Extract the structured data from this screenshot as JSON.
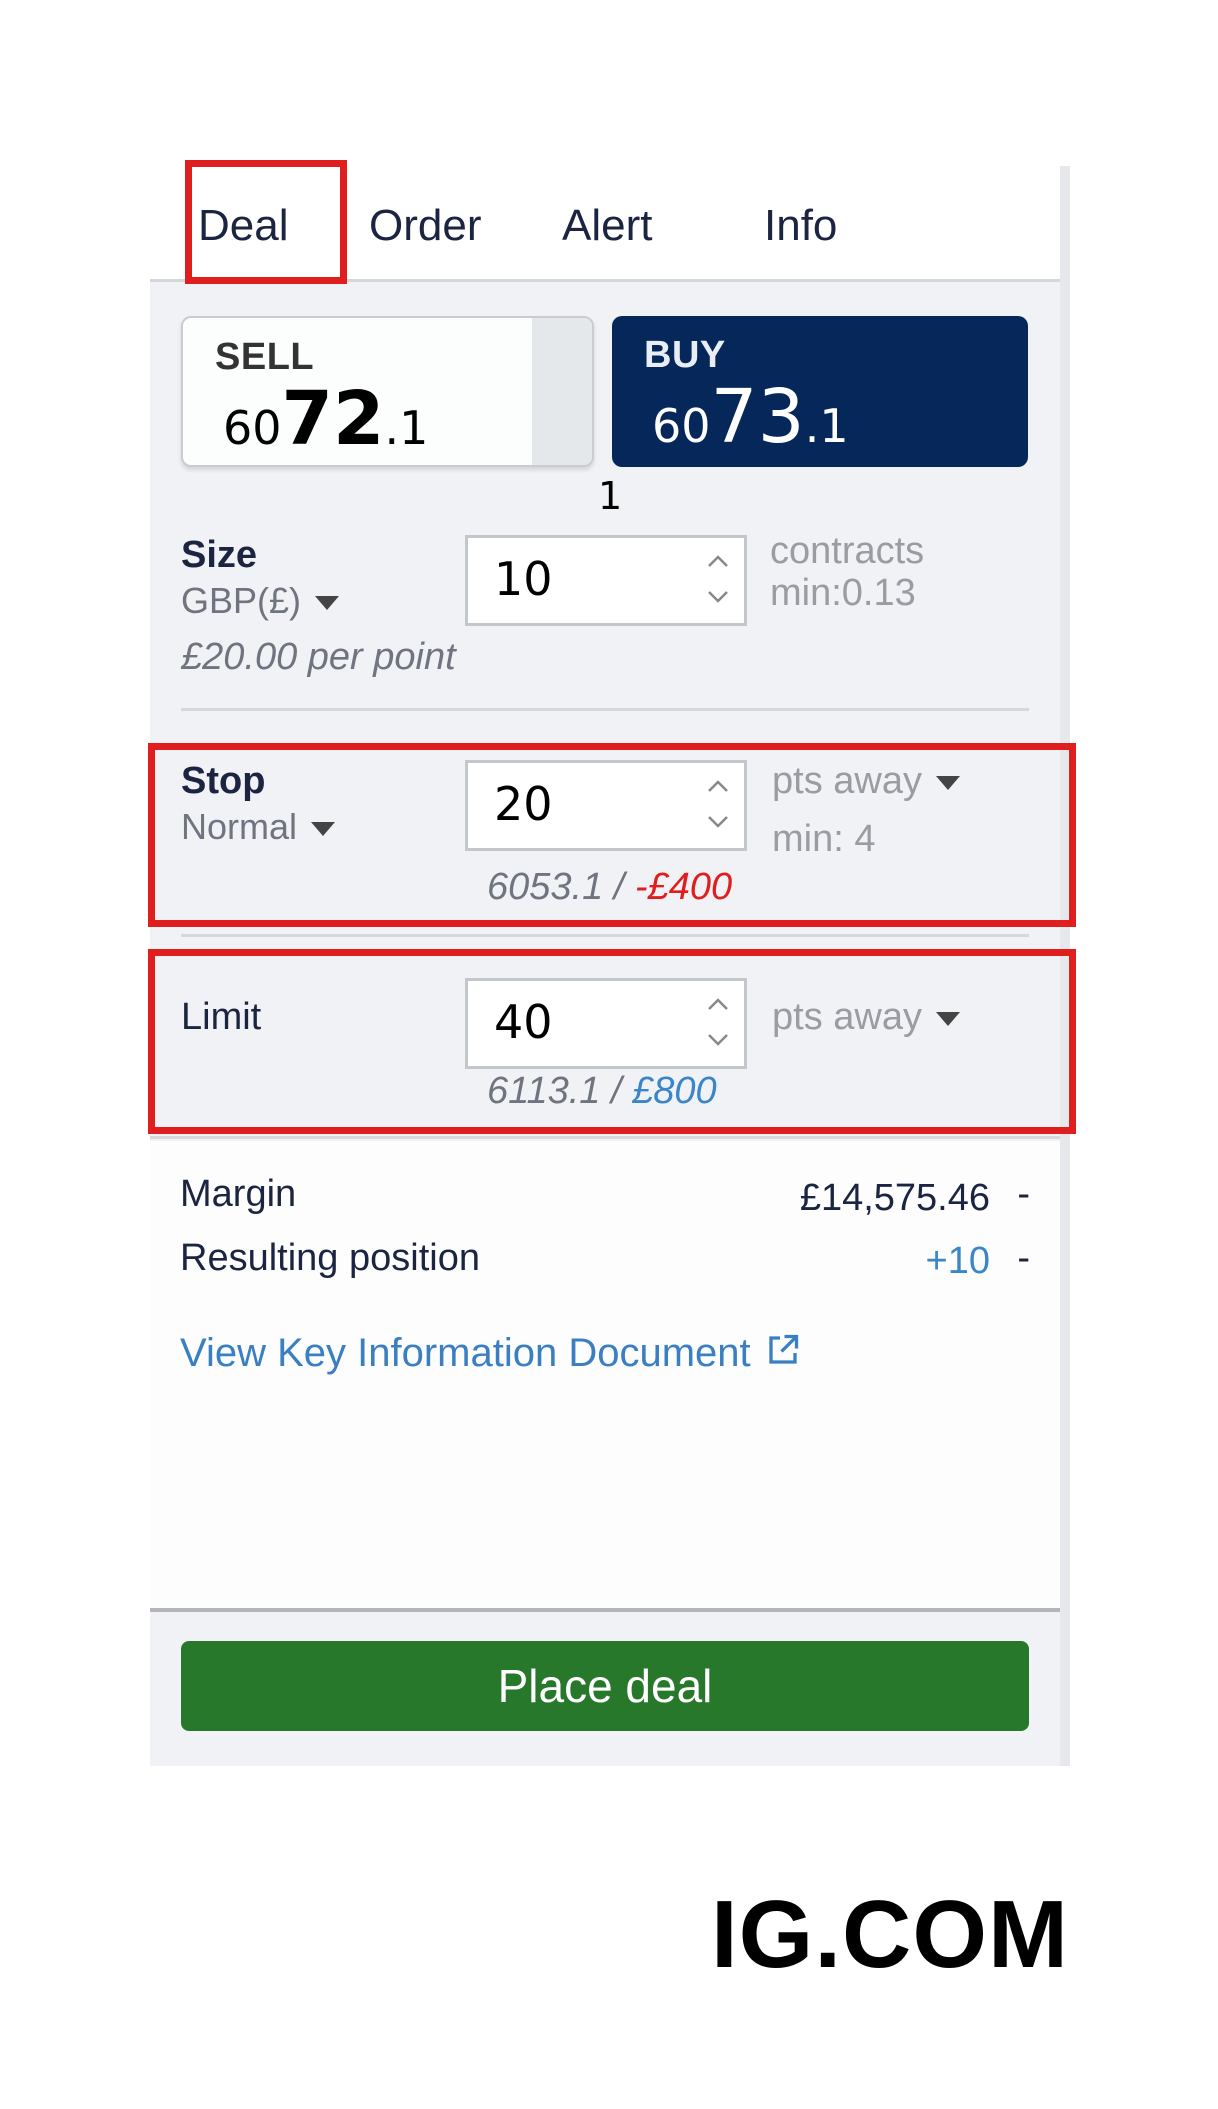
{
  "tabs": [
    {
      "label": "Deal",
      "active": true
    },
    {
      "label": "Order",
      "active": false
    },
    {
      "label": "Alert",
      "active": false
    },
    {
      "label": "Info",
      "active": false
    }
  ],
  "prices": {
    "sell": {
      "label": "SELL",
      "prefix": "60",
      "big": "72",
      "suffix": ".1"
    },
    "buy": {
      "label": "BUY",
      "prefix": "60",
      "big": "73",
      "suffix": ".1"
    },
    "spread": "1"
  },
  "size": {
    "label": "Size",
    "currency": "GBP(£)",
    "value": "10",
    "unit": "contracts",
    "min": "min:0.13",
    "per_point": "£20.00 per point"
  },
  "stop": {
    "label": "Stop",
    "type": "Normal",
    "value": "20",
    "unit": "pts away",
    "min": "min: 4",
    "level": "6053.1 / ",
    "amount": "-£400"
  },
  "limit": {
    "label": "Limit",
    "value": "40",
    "unit": "pts away",
    "level": "6113.1 / ",
    "amount": "£800"
  },
  "summary": {
    "margin_label": "Margin",
    "margin_value": "£14,575.46",
    "position_label": "Resulting position",
    "position_value": "+10",
    "dash": "-",
    "kid_link": "View Key Information Document"
  },
  "actions": {
    "place_deal": "Place deal"
  },
  "brand": "IG.COM",
  "colors": {
    "buy_bg": "#05275a",
    "place_deal_bg": "#27782b",
    "highlight": "#e01e1e",
    "negative": "#e01e1e",
    "positive": "#3a86c8",
    "link": "#3a7fc1"
  }
}
